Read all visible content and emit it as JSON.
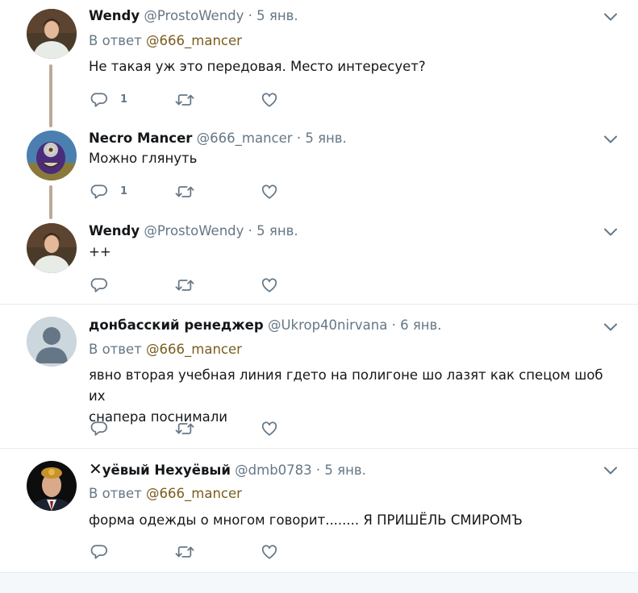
{
  "tweets": [
    {
      "name": "Wendy",
      "handle": "@ProstoWendy",
      "dot": "·",
      "time": "5 янв.",
      "reply_prefix": "В ответ",
      "reply_to": "@666_mancer",
      "text": "Не такая уж это передовая. Место интересует?",
      "reply_count": "1"
    },
    {
      "name": "Necro Mancer",
      "handle": "@666_mancer",
      "dot": "·",
      "time": "5 янв.",
      "text": "Можно глянуть",
      "reply_count": "1"
    },
    {
      "name": "Wendy",
      "handle": "@ProstoWendy",
      "dot": "·",
      "time": "5 янв.",
      "text": "++",
      "reply_count": ""
    },
    {
      "name": "донбасский ренеджер",
      "handle": "@Ukrop40nirvana",
      "dot": "·",
      "time": "6 янв.",
      "reply_prefix": "В ответ",
      "reply_to": "@666_mancer",
      "text_line1": "явно вторая учебная линия гдето на полигоне шо лазят как спецом шоб их",
      "text_line2": "снапера поснимали",
      "reply_count": ""
    },
    {
      "name_mark": "✕",
      "name": "уёвый Нехуёвый",
      "handle": "@dmb0783",
      "dot": "·",
      "time": "5 янв.",
      "reply_prefix": "В ответ",
      "reply_to": "@666_mancer",
      "text": "форма одежды о многом говорит........ Я ПРИШЁЛЬ СМИРОМЪ",
      "reply_count": ""
    }
  ],
  "icons": {
    "reply": "reply-icon",
    "retweet": "retweet-icon",
    "like": "like-icon",
    "caret": "chevron-down-icon"
  },
  "colors": {
    "text": "#14171a",
    "secondary": "#657786",
    "mention": "#7a5d1e",
    "thread_line": "#b8ab98",
    "divider": "#e6ecf0"
  }
}
